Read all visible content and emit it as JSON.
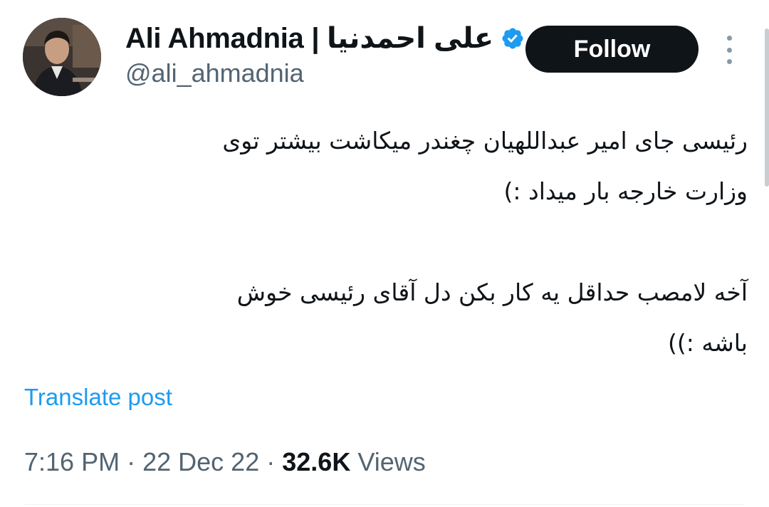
{
  "author": {
    "display_name": "Ali Ahmadnia | علی احمدنیا",
    "handle": "@ali_ahmadnia",
    "avatar_icon": "profile-photo",
    "verified_icon": "verified-badge-icon",
    "verified_color": "#1d9bf0"
  },
  "actions": {
    "follow_label": "Follow",
    "more_icon": "more-vertical-icon"
  },
  "tweet": {
    "lines": [
      "رئیسی جای امیر عبداللهیان چغندر میکاشت بیشتر توی",
      "وزارت خارجه بار میداد :)",
      "",
      "آخه لامصب حداقل یه کار بکن دل آقای رئیسی خوش",
      "باشه :))"
    ],
    "translate_label": "Translate post"
  },
  "meta": {
    "time": "7:16 PM",
    "date": "22 Dec 22",
    "separator": "·",
    "views_count": "32.6K",
    "views_label": "Views"
  },
  "colors": {
    "text_primary": "#0f1419",
    "text_secondary": "#536471",
    "link": "#1d9bf0",
    "button_bg": "#0f1419",
    "button_text": "#ffffff"
  }
}
